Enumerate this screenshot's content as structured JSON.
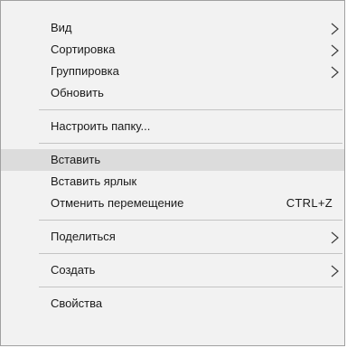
{
  "menu": {
    "items": [
      {
        "label": "Вид",
        "submenu": true
      },
      {
        "label": "Сортировка",
        "submenu": true
      },
      {
        "label": "Группировка",
        "submenu": true
      },
      {
        "label": "Обновить",
        "submenu": false
      },
      {
        "label": "Настроить папку...",
        "submenu": false
      },
      {
        "label": "Вставить",
        "submenu": false,
        "highlighted": true
      },
      {
        "label": "Вставить ярлык",
        "submenu": false
      },
      {
        "label": "Отменить перемещение",
        "shortcut": "CTRL+Z"
      },
      {
        "label": "Поделиться",
        "submenu": true
      },
      {
        "label": "Создать",
        "submenu": true
      },
      {
        "label": "Свойства",
        "submenu": false
      }
    ],
    "icons": {
      "submenu_arrow": "chevron-right-icon"
    },
    "colors": {
      "background": "#f2f2f2",
      "highlight": "#dcdcdc",
      "separator": "#c4c4c4",
      "border": "#a0a0a0"
    }
  }
}
